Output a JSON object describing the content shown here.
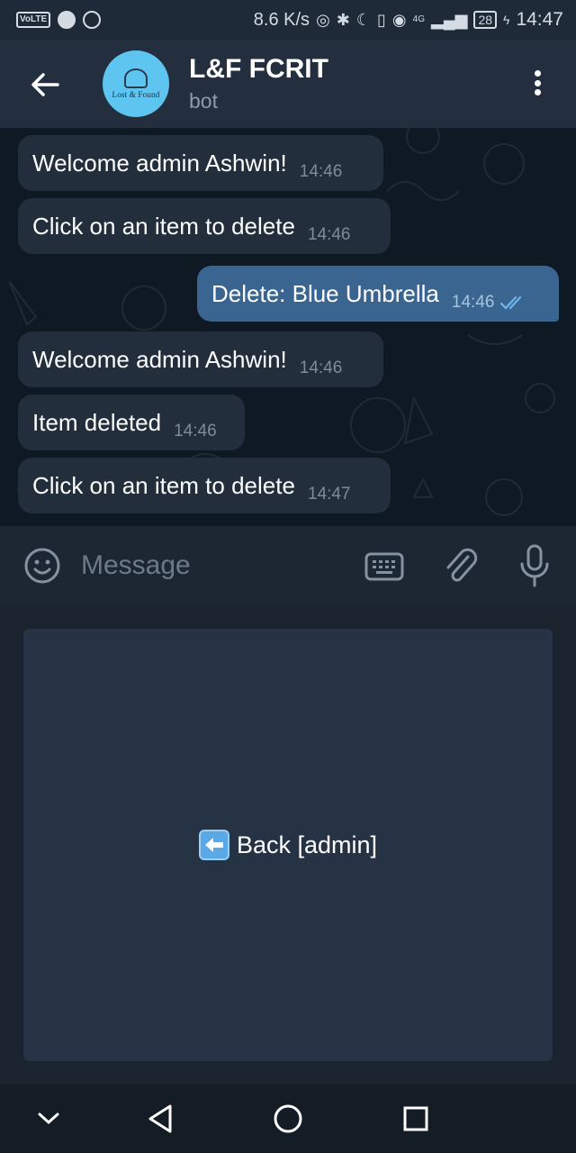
{
  "status_bar": {
    "volte": "VoLTE",
    "speed": "8.6 K/s",
    "network": "4G",
    "battery": "28",
    "time": "14:47",
    "icons": [
      "spotify-icon",
      "whatsapp-icon",
      "hotspot-icon",
      "bluetooth-icon",
      "moon-icon",
      "vibrate-icon",
      "eye-icon",
      "signal-icon",
      "charging-icon"
    ]
  },
  "header": {
    "title": "L&F FCRIT",
    "subtitle": "bot",
    "avatar_text": "Lost & Found",
    "back_icon": "arrow-left-icon",
    "menu_icon": "more-vertical-icon"
  },
  "messages": [
    {
      "text": "Welcome admin Ashwin!",
      "time": "14:46",
      "direction": "in"
    },
    {
      "text": "Click on an item to delete",
      "time": "14:46",
      "direction": "in"
    },
    {
      "text": "Delete: Blue Umbrella",
      "time": "14:46",
      "direction": "out",
      "status": "read"
    },
    {
      "text": "Welcome admin Ashwin!",
      "time": "14:46",
      "direction": "in"
    },
    {
      "text": "Item deleted",
      "time": "14:46",
      "direction": "in"
    },
    {
      "text": "Click on an item to delete",
      "time": "14:47",
      "direction": "in"
    }
  ],
  "input": {
    "placeholder": "Message",
    "value": "",
    "icons": [
      "emoji-icon",
      "keyboard-icon",
      "paperclip-icon",
      "microphone-icon"
    ]
  },
  "bot_keyboard": {
    "buttons": [
      {
        "label": "Back [admin]",
        "icon": "left-arrow-emoji-icon"
      }
    ]
  },
  "colors": {
    "header_bg": "#232f3e",
    "chat_bg": "#0f1923",
    "incoming_bubble": "#222e3c",
    "outgoing_bubble": "#3a6590",
    "read_check": "#6fb4ef",
    "avatar_bg": "#5ec5f0"
  }
}
